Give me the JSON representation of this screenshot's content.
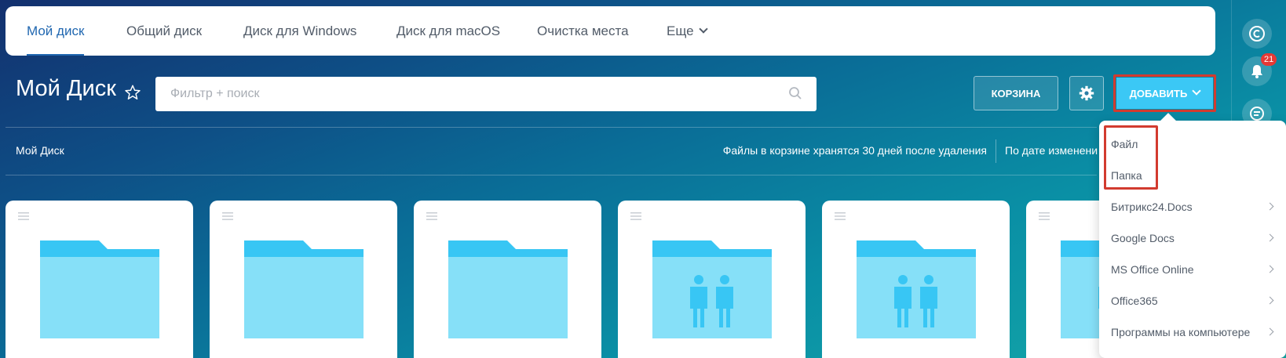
{
  "tabs": [
    {
      "label": "Мой диск",
      "active": true
    },
    {
      "label": "Общий диск",
      "active": false
    },
    {
      "label": "Диск для Windows",
      "active": false
    },
    {
      "label": "Диск для macOS",
      "active": false
    },
    {
      "label": "Очистка места",
      "active": false
    },
    {
      "label": "Еще",
      "active": false
    }
  ],
  "header": {
    "title": "Мой Диск",
    "search_placeholder": "Фильтр + поиск",
    "trash_label": "КОРЗИНА",
    "add_label": "ДОБАВИТЬ"
  },
  "toolbar": {
    "breadcrumb": "Мой Диск",
    "trash_info": "Файлы в корзине хранятся 30 дней после удаления",
    "sort_label": "По дате изменени"
  },
  "rail": {
    "notifications_count": "21"
  },
  "cards": [
    {
      "icon": "folder-icon"
    },
    {
      "icon": "folder-icon"
    },
    {
      "icon": "folder-icon"
    },
    {
      "icon": "shared-folder-icon"
    },
    {
      "icon": "shared-folder-icon"
    },
    {
      "icon": "shared-folder-icon"
    }
  ],
  "add_menu": {
    "items": [
      {
        "label": "Файл",
        "submenu": false
      },
      {
        "label": "Папка",
        "submenu": false
      },
      {
        "label": "Битрикс24.Docs",
        "submenu": true
      },
      {
        "label": "Google Docs",
        "submenu": true
      },
      {
        "label": "MS Office Online",
        "submenu": true
      },
      {
        "label": "Office365",
        "submenu": true
      },
      {
        "label": "Программы на компьютере",
        "submenu": true
      }
    ]
  },
  "colors": {
    "accent": "#2067b0",
    "add_button": "#3bc8f5",
    "highlight": "#d23b2f",
    "folder_front": "#86e0f8",
    "folder_back": "#38c6f4"
  }
}
